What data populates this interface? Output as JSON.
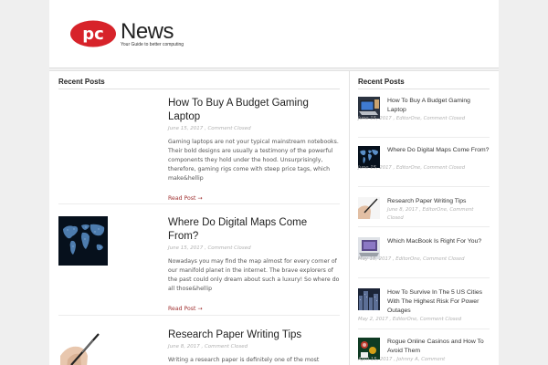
{
  "site": {
    "logo_letters": "pc",
    "name": "News",
    "tagline": "Your Guide to better computing"
  },
  "main": {
    "heading": "Recent Posts",
    "posts": [
      {
        "title": "How To Buy A Budget Gaming Laptop",
        "meta": "June 15, 2017 , Comment Closed",
        "excerpt": "Gaming laptops are not your typical mainstream notebooks. Their bold designs are usually a testimony of the powerful components they hold under the hood. Unsurprisingly, therefore, gaming rigs come with steep price tags, which make&hellip",
        "more": "Read Post →",
        "thumb_icon": "no-thumbnail"
      },
      {
        "title": "Where Do Digital Maps Come From?",
        "meta": "June 15, 2017 , Comment Closed",
        "excerpt": "Nowadays you may find the map almost for every corner of our manifold planet in the internet. The brave explorers of the past could only dream about such a luxury! So where do all those&hellip",
        "more": "Read Post →",
        "thumb_icon": "world-map-icon"
      },
      {
        "title": "Research Paper Writing Tips",
        "meta": "June 8, 2017 , Comment Closed",
        "excerpt": "Writing a research paper is definitely one of the most dreaded",
        "more": "",
        "thumb_icon": "pen-writing-icon"
      }
    ]
  },
  "sidebar": {
    "heading": "Recent Posts",
    "items": [
      {
        "title": "How To Buy A Budget Gaming Laptop",
        "meta": "June 15, 2017 , EditorOne, Comment Closed",
        "thumb_icon": "laptop-icon"
      },
      {
        "title": "Where Do Digital Maps Come From?",
        "meta": "June 15, 2017 , EditorOne, Comment Closed",
        "thumb_icon": "world-map-icon"
      },
      {
        "title": "Research Paper Writing Tips",
        "meta": "June 8, 2017 , EditorOne, Comment Closed",
        "thumb_icon": "pen-writing-icon"
      },
      {
        "title": "Which MacBook Is Right For You?",
        "meta": "May 18, 2017 , EditorOne, Comment Closed",
        "thumb_icon": "macbook-icon"
      },
      {
        "title": "How To Survive In The 5 US Cities With The Highest Risk For Power Outages",
        "meta": "May 2, 2017 , EditorOne, Comment Closed",
        "thumb_icon": "city-icon"
      },
      {
        "title": "Rogue Online Casinos and How To Avoid Them",
        "meta": "April 15, 2017 , Johnny A, Comment",
        "thumb_icon": "casino-icon"
      }
    ]
  },
  "colors": {
    "logo_red": "#d7232a",
    "read_more": "#a03232"
  }
}
